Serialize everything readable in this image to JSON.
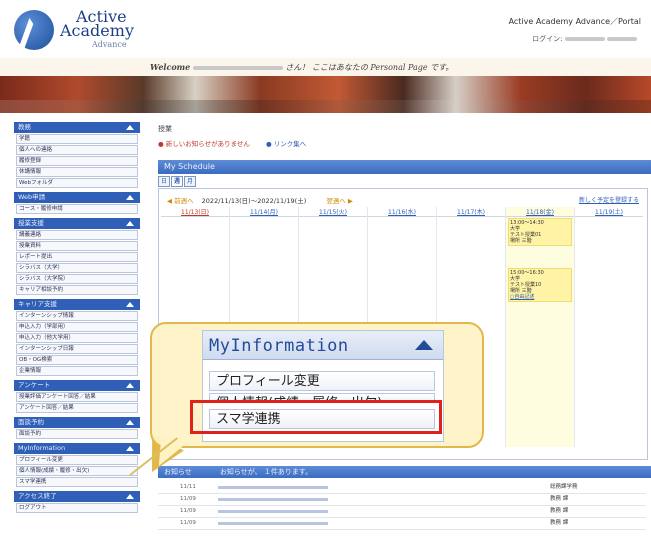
{
  "header": {
    "logo_line1": "Active",
    "logo_line2": "Academy",
    "logo_sub": "Advance",
    "portal_title": "Active Academy Advance／Portal",
    "login_label": "ログイン:"
  },
  "welcome": {
    "prefix": "Welcome",
    "suffix": "さん！ ここはあなたの Personal Page です。"
  },
  "sidebar": {
    "sections": [
      {
        "title": "教務",
        "items": [
          "学籍",
          "個人への連絡",
          "履修登録",
          "休講情報",
          "Webフォルダ"
        ]
      },
      {
        "title": "Web申請",
        "items": [
          "コース・履修申請"
        ]
      },
      {
        "title": "授業支援",
        "items": [
          "講義連絡",
          "授業資料",
          "レポート提出",
          "シラバス（大学）",
          "シラバス（大学院）",
          "キャリア相談予約"
        ]
      },
      {
        "title": "キャリア支援",
        "items": [
          "インターンシップ情報",
          "申込入力（学部用）",
          "申込入力（他大学用）",
          "インターンシップ日報",
          "OB・OG検索",
          "企業情報"
        ]
      },
      {
        "title": "アンケート",
        "items": [
          "授業評価アンケート回答／結果",
          "アンケート回答／結果"
        ]
      },
      {
        "title": "面談予約",
        "items": [
          "面談予約"
        ]
      },
      {
        "title": "MyInformation",
        "items": [
          "プロフィール変更",
          "個人情報(成績・履修・出欠)",
          "スマ学連携"
        ]
      },
      {
        "title": "アクセス終了",
        "items": [
          "ログアウト"
        ]
      }
    ]
  },
  "main": {
    "crumb": "授業",
    "notice_new": "● 新しいお知らせがありません",
    "notice_links": "● リンク集へ",
    "schedule_title": "My Schedule",
    "tabs": [
      "日",
      "週",
      "月"
    ],
    "prev_label": "◀ 前週へ",
    "week_range": "2022/11/13(日)〜2022/11/19(土)",
    "next_label": "翌週へ ▶",
    "add_link": "新しく予定を登録する",
    "days": [
      "11/13(日)",
      "11/14(月)",
      "11/15(火)",
      "11/16(水)",
      "11/17(木)",
      "11/18(金)",
      "11/19(土)"
    ],
    "events": [
      {
        "time": "13:00〜14:30",
        "place": "大学",
        "title": "テスト授業01",
        "room": "場所 三階",
        "link": ""
      },
      {
        "time": "15:00〜16:30",
        "place": "大学",
        "title": "テスト授業10",
        "room": "場所 三階",
        "link": "○自由記述"
      }
    ],
    "info_bar": "お知らせ　　　　お知らせが、 １件あります。",
    "news": [
      {
        "date": "11/11",
        "dept": "総務課学務"
      },
      {
        "date": "11/09",
        "dept": "教務 課"
      },
      {
        "date": "11/09",
        "dept": "教務 課"
      },
      {
        "date": "11/09",
        "dept": "教務 課"
      }
    ]
  },
  "callout": {
    "panel_title": "MyInformation",
    "item1": "プロフィール変更",
    "item2": "個人情報(成績・履修・出欠)",
    "item3": "スマ学連携"
  },
  "colors": {
    "accent": "#2f5fb6",
    "highlight_border": "#e0201b",
    "callout_fill": "#fff3c4"
  }
}
